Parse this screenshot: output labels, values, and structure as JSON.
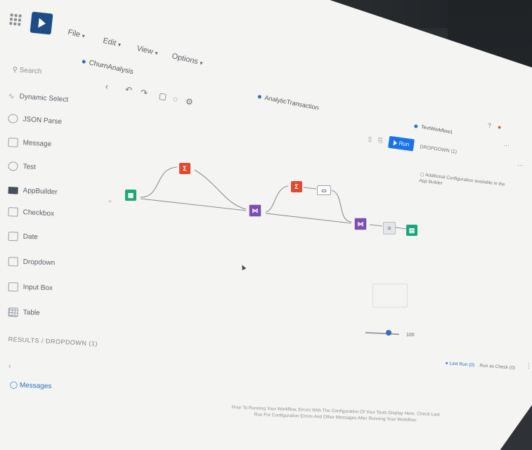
{
  "menu": {
    "file": "File",
    "edit": "Edit",
    "view": "View",
    "options": "Options"
  },
  "workflow_tab": "ChurnAnalysis",
  "sidebar": {
    "search_placeholder": "Search",
    "items": [
      {
        "label": "Dynamic Select",
        "icon": "wave-icon"
      },
      {
        "label": "JSON Parse",
        "icon": "json-icon"
      },
      {
        "label": "Message",
        "icon": "message-icon"
      },
      {
        "label": "Test",
        "icon": "test-icon"
      },
      {
        "label": "AppBuilder",
        "icon": "folder-icon"
      },
      {
        "label": "Checkbox",
        "icon": "checkbox-icon"
      },
      {
        "label": "Date",
        "icon": "calendar-icon"
      },
      {
        "label": "Dropdown",
        "icon": "dropdown-icon"
      },
      {
        "label": "Input Box",
        "icon": "input-box-icon"
      },
      {
        "label": "Table",
        "icon": "table-icon"
      }
    ],
    "results_label": "RESULTS / DROPDOWN (1)",
    "messages_label": "Messages"
  },
  "canvas": {
    "title": "AnalyticTransaction",
    "zoom": "100"
  },
  "right_panel": {
    "title": "TextWorkflow1",
    "subtitle": "DROPDOWN (1)",
    "run_label": "Run",
    "note": "Additional Configuration available in the App Builder"
  },
  "bottom_tabs": {
    "last_run": "Last Run (0)",
    "run_as_check": "Run as Check (0)"
  },
  "hint_text": "Prior To Running Your Workflow, Errors With The Configuration Of Your Tools Display Here. Check Last Run For Configuration Errors And Other Messages After Running Your Workflow.",
  "colors": {
    "accent": "#1a73e8",
    "brand": "#1e4c86",
    "tool_green": "#19a97b",
    "tool_red": "#e2492f",
    "tool_purple": "#7a4fb0"
  }
}
